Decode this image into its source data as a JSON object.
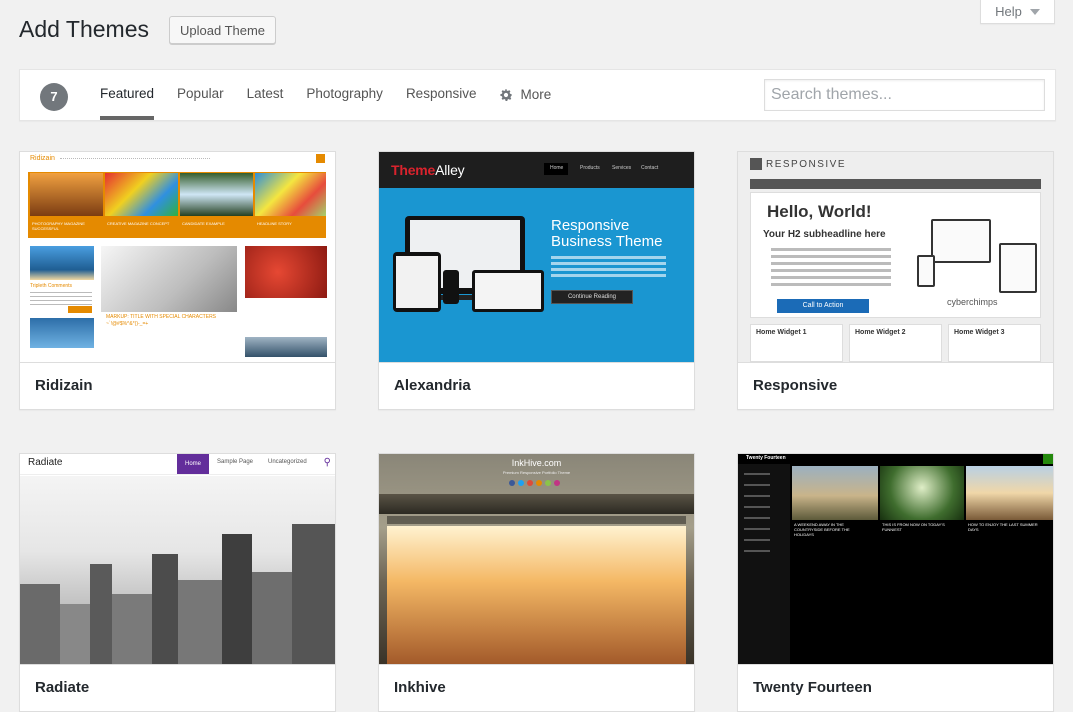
{
  "header": {
    "title": "Add Themes",
    "upload_label": "Upload Theme",
    "help_label": "Help"
  },
  "filters": {
    "count": "7",
    "links": [
      "Featured",
      "Popular",
      "Latest",
      "Photography",
      "Responsive"
    ],
    "more_label": "More",
    "search_placeholder": "Search themes..."
  },
  "themes": [
    {
      "name": "Ridizain",
      "shot": {
        "logo": "Ridizain",
        "cap_1": "PHOTOGRAPHY MAGAZINE SUCCESSFUL",
        "cap_2": "CREATIVE MAGAZINE CONCEPT",
        "cap_3": "CANDIDATE EXAMPLE",
        "cap_4": "HEADLINE STORY",
        "side_title": "Tripleth Comments",
        "main_caption": "MARKUP: TITLE WITH SPECIAL CHARACTERS ~`!@#$%^&*()-_=+"
      }
    },
    {
      "name": "Alexandria",
      "shot": {
        "logo_red": "Theme",
        "logo_white": "Alley",
        "nav": [
          "Home",
          "Products",
          "Services",
          "Contact"
        ],
        "headline": "Responsive Business Theme",
        "button": "Continue Reading"
      }
    },
    {
      "name": "Responsive",
      "shot": {
        "logo": "RESPONSIVE",
        "hero_title": "Hello, World!",
        "hero_sub": "Your H2 subheadline here",
        "cta": "Call to Action",
        "brand": "cyberchimps",
        "widgets": [
          "Home Widget 1",
          "Home Widget 2",
          "Home Widget 3"
        ]
      }
    },
    {
      "name": "Radiate",
      "shot": {
        "logo": "Radiate",
        "nav_home": "Home",
        "nav": [
          "Sample Page",
          "Uncategorized"
        ]
      }
    },
    {
      "name": "Inkhive",
      "shot": {
        "title": "InkHive.com",
        "subtitle": "Premium Responsive Portfolio Theme"
      }
    },
    {
      "name": "Twenty Fourteen",
      "shot": {
        "title": "Twenty Fourteen",
        "cap_1": "A WEEKEND AWAY IN THE COUNTRYSIDE BEFORE THE HOLIDAYS",
        "cap_2": "THIS IS FROM NOW ON TODAY'S FUNNIEST",
        "cap_3": "HOW TO ENJOY THE LAST SUMMER DAYS"
      }
    }
  ],
  "colors": {
    "accent_orange": "#e58a00",
    "alexandria_blue": "#1a96d1",
    "radiate_purple": "#632e9b",
    "tf_green": "#24890d"
  }
}
